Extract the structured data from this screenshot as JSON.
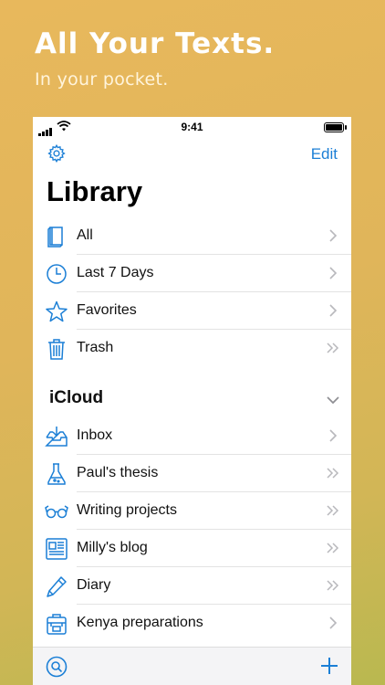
{
  "promo": {
    "title": "All Your Texts.",
    "subtitle": "In your pocket."
  },
  "status_bar": {
    "time": "9:41"
  },
  "nav": {
    "settings_icon": "gear-icon",
    "edit_label": "Edit"
  },
  "library": {
    "title": "Library",
    "items": [
      {
        "label": "All",
        "icon": "book-icon",
        "chevron": "single"
      },
      {
        "label": "Last 7 Days",
        "icon": "clock-icon",
        "chevron": "single"
      },
      {
        "label": "Favorites",
        "icon": "star-icon",
        "chevron": "single"
      },
      {
        "label": "Trash",
        "icon": "trash-icon",
        "chevron": "double"
      }
    ]
  },
  "icloud": {
    "title": "iCloud",
    "items": [
      {
        "label": "Inbox",
        "icon": "inbox-icon",
        "chevron": "single"
      },
      {
        "label": "Paul's thesis",
        "icon": "flask-icon",
        "chevron": "double"
      },
      {
        "label": "Writing projects",
        "icon": "glasses-icon",
        "chevron": "double"
      },
      {
        "label": "Milly's blog",
        "icon": "newspaper-icon",
        "chevron": "double"
      },
      {
        "label": "Diary",
        "icon": "pencil-icon",
        "chevron": "double"
      },
      {
        "label": "Kenya preparations",
        "icon": "backpack-icon",
        "chevron": "single"
      }
    ]
  },
  "toolbar": {
    "search_icon": "search-icon",
    "add_icon": "plus-icon"
  },
  "colors": {
    "accent": "#1b7fd6",
    "background_top": "#e8b85c",
    "background_bottom": "#b9b850"
  }
}
